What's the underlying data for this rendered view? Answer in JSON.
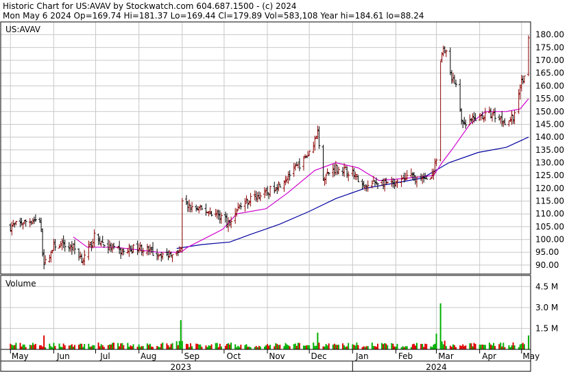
{
  "header": {
    "line1": "Historic Chart for US:AVAV by Stockwatch.com 604.687.1500 - (c) 2024",
    "line2": "Mon May  6 2024   Op=169.74  Hi=181.37  Lo=169.44  Cl=179.89  Vol=583,108  Year hi=184.61  lo=88.24"
  },
  "colors": {
    "up_bar": "#8b0000",
    "down_bar": "#000000",
    "ma_short": "#d000d0",
    "ma_long": "#0000a0",
    "volume_up": "#00b000",
    "volume_down": "#e00000"
  },
  "chart_data": [
    {
      "type": "line",
      "panel": "price",
      "symbol_label": "US:AVAV",
      "y_ticks": [
        "180.00",
        "175.00",
        "170.00",
        "165.00",
        "160.00",
        "155.00",
        "150.00",
        "145.00",
        "140.00",
        "135.00",
        "130.00",
        "125.00",
        "120.00",
        "115.00",
        "110.00",
        "105.00",
        "100.00",
        "95.00",
        "90.00"
      ],
      "ylim": [
        86.5,
        185
      ],
      "x_month_labels": [
        "May",
        "Jun",
        "Jul",
        "Aug",
        "Sep",
        "Oct",
        "Nov",
        "Dec",
        "Jan",
        "Feb",
        "Mar",
        "Apr",
        "May"
      ],
      "year_labels": [
        "2023",
        "2024"
      ],
      "series": [
        {
          "kind": "price",
          "points": [
            [
              "2023-05-01",
              105
            ],
            [
              "2023-05-12",
              107
            ],
            [
              "2023-05-22",
              108
            ],
            [
              "2023-05-25",
              90
            ],
            [
              "2023-06-02",
              98
            ],
            [
              "2023-06-15",
              97
            ],
            [
              "2023-06-22",
              92
            ],
            [
              "2023-06-30",
              101
            ],
            [
              "2023-07-10",
              97
            ],
            [
              "2023-07-20",
              95
            ],
            [
              "2023-07-31",
              97
            ],
            [
              "2023-08-10",
              95
            ],
            [
              "2023-08-21",
              94
            ],
            [
              "2023-08-31",
              97
            ],
            [
              "2023-09-01",
              114
            ],
            [
              "2023-09-10",
              112
            ],
            [
              "2023-09-20",
              111
            ],
            [
              "2023-09-30",
              109
            ],
            [
              "2023-10-05",
              106
            ],
            [
              "2023-10-10",
              112
            ],
            [
              "2023-10-20",
              116
            ],
            [
              "2023-10-31",
              118
            ],
            [
              "2023-11-10",
              122
            ],
            [
              "2023-11-20",
              127
            ],
            [
              "2023-11-30",
              133
            ],
            [
              "2023-12-07",
              142
            ],
            [
              "2023-12-10",
              124
            ],
            [
              "2023-12-20",
              128
            ],
            [
              "2024-01-02",
              126
            ],
            [
              "2024-01-09",
              120
            ],
            [
              "2024-01-20",
              123
            ],
            [
              "2024-01-31",
              121
            ],
            [
              "2024-02-10",
              125
            ],
            [
              "2024-02-20",
              123
            ],
            [
              "2024-02-28",
              126
            ],
            [
              "2024-03-01",
              131
            ],
            [
              "2024-03-04",
              170
            ],
            [
              "2024-03-07",
              175
            ],
            [
              "2024-03-11",
              165
            ],
            [
              "2024-03-16",
              158
            ],
            [
              "2024-03-20",
              144
            ],
            [
              "2024-03-31",
              148
            ],
            [
              "2024-04-10",
              149
            ],
            [
              "2024-04-20",
              146
            ],
            [
              "2024-04-26",
              148
            ],
            [
              "2024-04-29",
              158
            ],
            [
              "2024-05-03",
              165
            ],
            [
              "2024-05-06",
              180
            ]
          ]
        },
        {
          "kind": "ma_short",
          "points": [
            [
              "2023-06-15",
              101
            ],
            [
              "2023-06-25",
              97
            ],
            [
              "2023-07-15",
              97
            ],
            [
              "2023-08-15",
              95
            ],
            [
              "2023-08-31",
              95
            ],
            [
              "2023-09-05",
              97
            ],
            [
              "2023-09-30",
              104
            ],
            [
              "2023-10-10",
              110
            ],
            [
              "2023-10-31",
              112
            ],
            [
              "2023-11-15",
              118
            ],
            [
              "2023-12-05",
              127
            ],
            [
              "2023-12-20",
              130
            ],
            [
              "2024-01-05",
              128
            ],
            [
              "2024-01-20",
              123
            ],
            [
              "2024-02-10",
              124
            ],
            [
              "2024-02-28",
              125
            ],
            [
              "2024-03-05",
              130
            ],
            [
              "2024-03-12",
              135
            ],
            [
              "2024-03-25",
              145
            ],
            [
              "2024-04-05",
              150
            ],
            [
              "2024-04-20",
              150
            ],
            [
              "2024-04-30",
              151
            ],
            [
              "2024-05-06",
              155
            ]
          ]
        },
        {
          "kind": "ma_long",
          "points": [
            [
              "2023-08-28",
              96.5
            ],
            [
              "2023-09-15",
              98
            ],
            [
              "2023-10-05",
              99
            ],
            [
              "2023-10-20",
              102
            ],
            [
              "2023-11-10",
              106
            ],
            [
              "2023-12-01",
              111
            ],
            [
              "2023-12-20",
              116
            ],
            [
              "2024-01-10",
              120
            ],
            [
              "2024-01-31",
              122
            ],
            [
              "2024-02-20",
              124
            ],
            [
              "2024-03-10",
              130
            ],
            [
              "2024-03-31",
              134
            ],
            [
              "2024-04-20",
              136
            ],
            [
              "2024-05-06",
              140
            ]
          ]
        }
      ]
    },
    {
      "type": "bar",
      "panel": "volume",
      "title": "Volume",
      "y_ticks": [
        "4.5 M",
        "3.0 M",
        "1.5 M"
      ],
      "ylim": [
        0,
        5.3
      ],
      "spikes_millions": [
        [
          "2023-05-25",
          1.0
        ],
        [
          "2023-08-31",
          2.1
        ],
        [
          "2023-12-07",
          1.2
        ],
        [
          "2024-03-04",
          3.3
        ],
        [
          "2024-05-06",
          1.0
        ]
      ]
    }
  ]
}
